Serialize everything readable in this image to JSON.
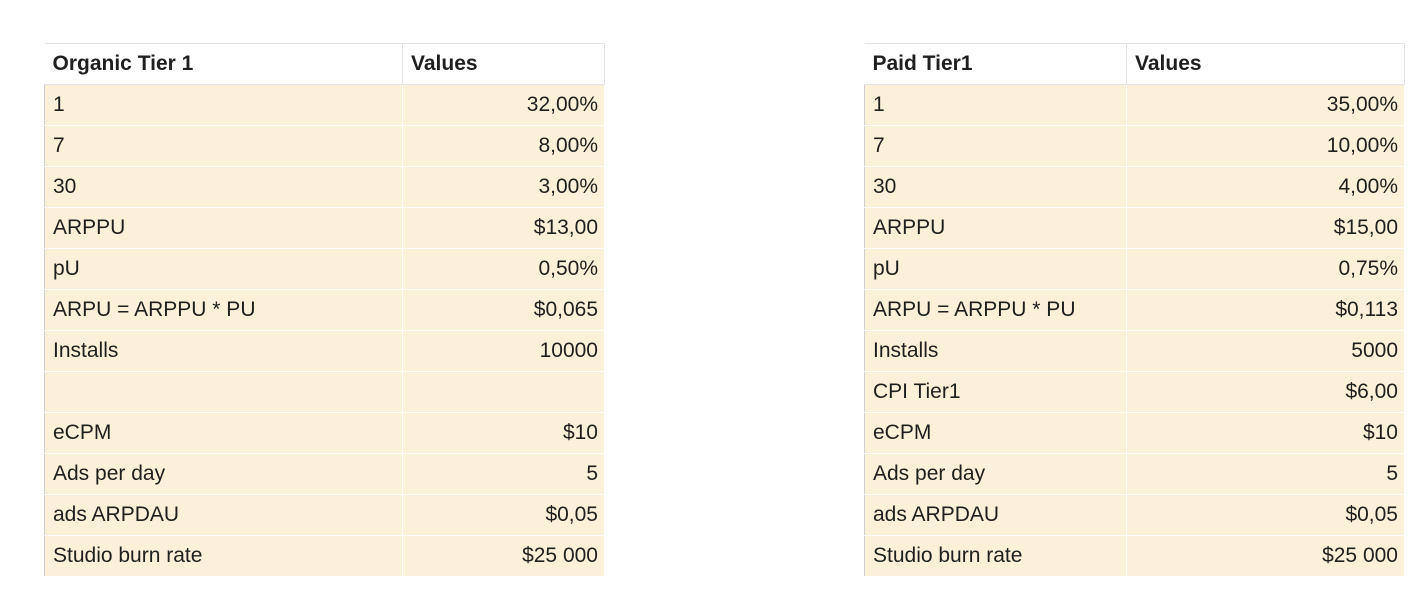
{
  "left": {
    "header": {
      "label": "Organic Tier 1",
      "value": "Values"
    },
    "rows": [
      {
        "label": "1",
        "value": "32,00%"
      },
      {
        "label": "7",
        "value": "8,00%"
      },
      {
        "label": "30",
        "value": "3,00%"
      },
      {
        "label": "ARPPU",
        "value": "$13,00"
      },
      {
        "label": "pU",
        "value": "0,50%"
      },
      {
        "label": "ARPU = ARPPU * PU",
        "value": "$0,065"
      },
      {
        "label": "Installs",
        "value": "10000"
      },
      {
        "label": "",
        "value": ""
      },
      {
        "label": "eCPM",
        "value": "$10"
      },
      {
        "label": "Ads per day",
        "value": "5"
      },
      {
        "label": "ads ARPDAU",
        "value": "$0,05"
      },
      {
        "label": "Studio burn rate",
        "value": "$25 000"
      }
    ]
  },
  "right": {
    "header": {
      "label": "Paid Tier1",
      "value": "Values"
    },
    "rows": [
      {
        "label": "1",
        "value": "35,00%"
      },
      {
        "label": "7",
        "value": "10,00%"
      },
      {
        "label": "30",
        "value": "4,00%"
      },
      {
        "label": "ARPPU",
        "value": "$15,00"
      },
      {
        "label": "pU",
        "value": "0,75%"
      },
      {
        "label": "ARPU = ARPPU * PU",
        "value": "$0,113"
      },
      {
        "label": "Installs",
        "value": "5000"
      },
      {
        "label": "CPI Tier1",
        "value": "$6,00"
      },
      {
        "label": "eCPM",
        "value": "$10"
      },
      {
        "label": "Ads per day",
        "value": "5"
      },
      {
        "label": "ads ARPDAU",
        "value": "$0,05"
      },
      {
        "label": "Studio burn rate",
        "value": "$25 000"
      }
    ]
  }
}
